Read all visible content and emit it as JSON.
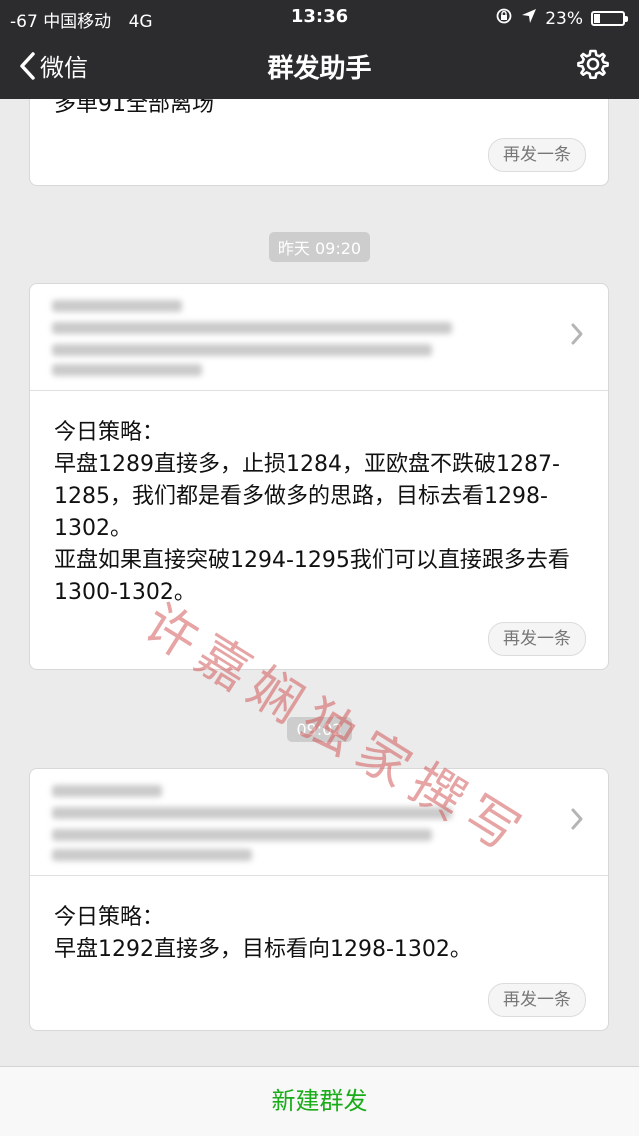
{
  "status_bar": {
    "signal": "-67",
    "carrier": "中国移动",
    "network": "4G",
    "time": "13:36",
    "battery_percent": "23%",
    "battery_level": 0.23
  },
  "nav": {
    "back_label": "微信",
    "title": "群发助手"
  },
  "messages": [
    {
      "partial_text": "多单91全部离场",
      "resend_label": "再发一条"
    },
    {
      "time": "昨天 09:20",
      "body": "今日策略：\n早盘1289直接多，止损1284，亚欧盘不跌破1287-1285，我们都是看多做多的思路，目标去看1298-1302。\n亚盘如果直接突破1294-1295我们可以直接跟多去看1300-1302。",
      "resend_label": "再发一条"
    },
    {
      "time": "09:02",
      "body": "今日策略：\n早盘1292直接多，目标看向1298-1302。",
      "resend_label": "再发一条"
    }
  ],
  "bottom": {
    "new_broadcast_label": "新建群发"
  },
  "watermark": {
    "chars": [
      "许",
      "嘉",
      "娴",
      "独",
      "家",
      "撰",
      "写"
    ]
  }
}
